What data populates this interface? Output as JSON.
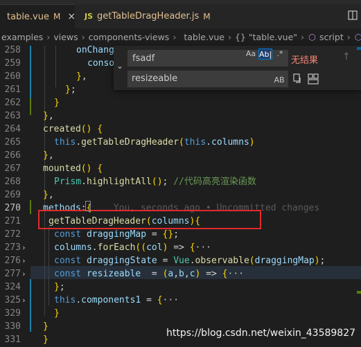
{
  "tabs": [
    {
      "name": "table.vue",
      "flag": "M",
      "close": "×"
    },
    {
      "name": "getTableDragHeader.js",
      "flag": "M",
      "icon": "JS"
    }
  ],
  "breadcrumb": [
    "examples",
    "views",
    "components-views",
    "table.vue",
    "{} \"table.vue\"",
    "script",
    "de"
  ],
  "find": {
    "find_value": "fsadf",
    "replace_value": "resizeable",
    "no_results": "无结果",
    "match_case": "Aa",
    "whole_word": "Ab|",
    "regex": ".*",
    "preserve_case": "AB"
  },
  "lines": [
    {
      "n": "258",
      "text": "onChange"
    },
    {
      "n": "259",
      "text": "conso"
    },
    {
      "n": "260",
      "text": "},"
    },
    {
      "n": "261",
      "text": "};"
    },
    {
      "n": "262",
      "text": "}"
    },
    {
      "n": "263",
      "text": "},"
    },
    {
      "n": "264",
      "text": "created() {"
    },
    {
      "n": "265",
      "text": "this.getTableDragHeader(this.columns)"
    },
    {
      "n": "266",
      "text": "},"
    },
    {
      "n": "267",
      "text": "mounted() {"
    },
    {
      "n": "268",
      "text": "Prism.highlightAll(); //代码高亮渲染函数"
    },
    {
      "n": "269",
      "text": "},"
    },
    {
      "n": "270",
      "text": "methods:{",
      "blame": "You, seconds ago • Uncommitted changes"
    },
    {
      "n": "271",
      "text": "getTableDragHeader(columns){"
    },
    {
      "n": "272",
      "text": "const draggingMap = {};"
    },
    {
      "n": "273",
      "text": "columns.forEach((col) => {···"
    },
    {
      "n": "276",
      "text": "const draggingState = Vue.observable(draggingMap);"
    },
    {
      "n": "277",
      "text": "const resizeable  = (a,b,c) => {···"
    },
    {
      "n": "324",
      "text": "};"
    },
    {
      "n": "325",
      "text": "this.components1 = {···"
    },
    {
      "n": "329",
      "text": "}"
    },
    {
      "n": "330",
      "text": "}"
    },
    {
      "n": "331",
      "text": "}"
    }
  ],
  "watermark": "https://blog.csdn.net/weixin_43589827",
  "colors": {
    "accent": "#007acc",
    "modified": "#e2c08d",
    "highlight_box": "#e02a2a"
  }
}
